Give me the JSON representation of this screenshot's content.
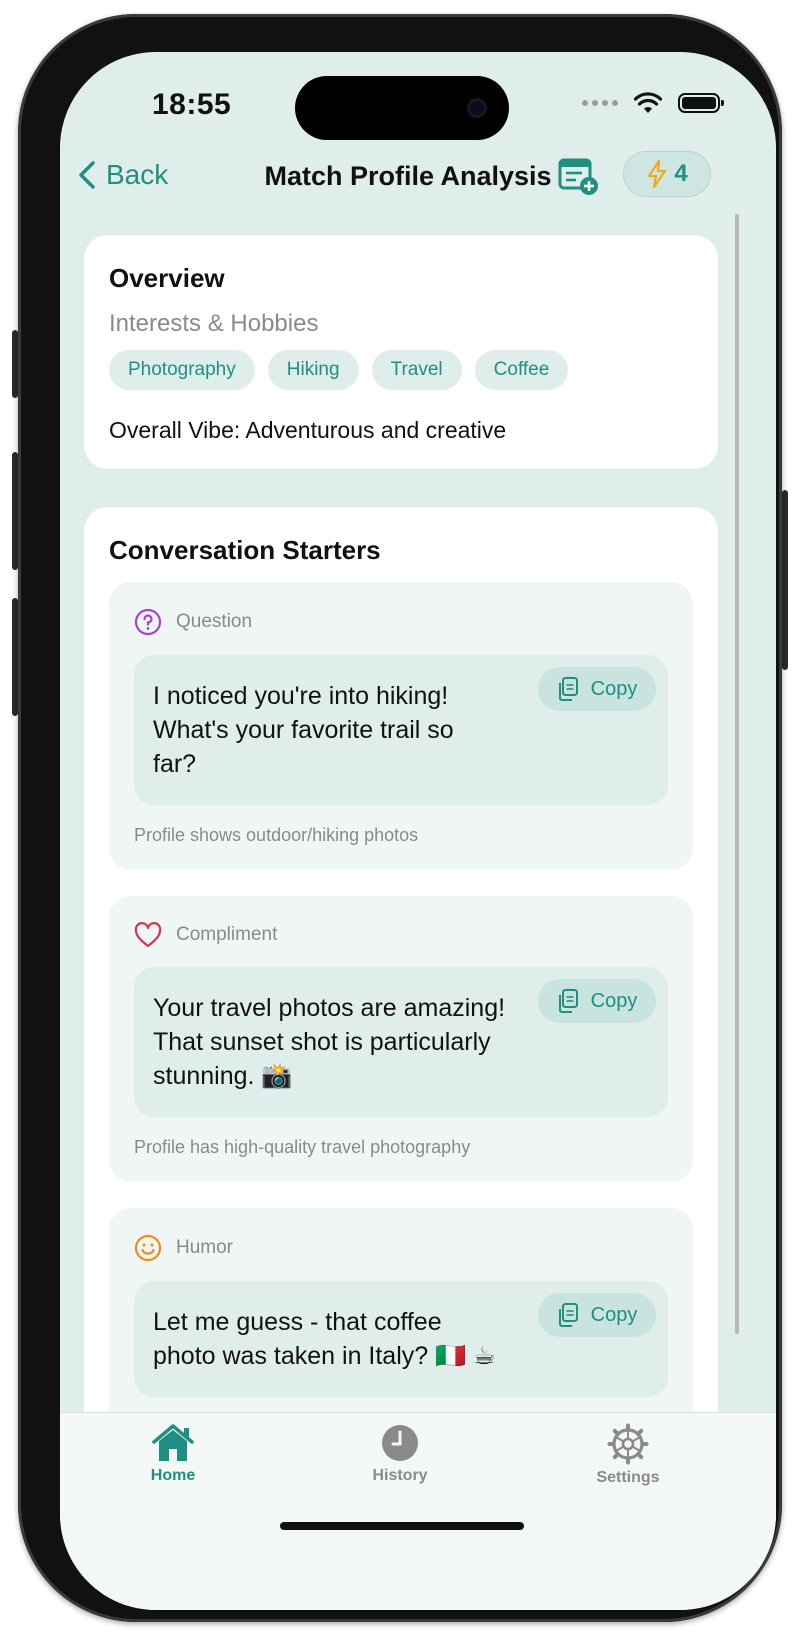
{
  "status": {
    "time": "18:55"
  },
  "nav": {
    "back_label": "Back",
    "title": "Match Profile Analysis",
    "credits": "4"
  },
  "overview": {
    "title": "Overview",
    "interests_label": "Interests & Hobbies",
    "interests": [
      "Photography",
      "Hiking",
      "Travel",
      "Coffee"
    ],
    "vibe": "Overall Vibe: Adventurous and creative"
  },
  "starters": {
    "title": "Conversation Starters",
    "copy_label": "Copy",
    "items": [
      {
        "type": "Question",
        "icon": "question-circle-icon",
        "color": "#a53fd6",
        "text": "I noticed you're into hiking!\nWhat's your favorite trail so\nfar?",
        "reason": "Profile shows outdoor/hiking photos"
      },
      {
        "type": "Compliment",
        "icon": "heart-icon",
        "color": "#e0314b",
        "text": "Your travel photos are amazing!\nThat sunset shot is particularly\nstunning. 📸",
        "reason": "Profile has high-quality travel photography"
      },
      {
        "type": "Humor",
        "icon": "smiley-icon",
        "color": "#ef8c1e",
        "text": "Let me guess - that coffee\nphoto was taken in Italy? 🇮🇹 ☕",
        "reason": ""
      }
    ]
  },
  "tabs": [
    {
      "label": "Home",
      "active": true
    },
    {
      "label": "History",
      "active": false
    },
    {
      "label": "Settings",
      "active": false
    }
  ],
  "colors": {
    "accent": "#1f8f82",
    "background": "#dfeeeb",
    "inactive": "#8a8a8a"
  }
}
